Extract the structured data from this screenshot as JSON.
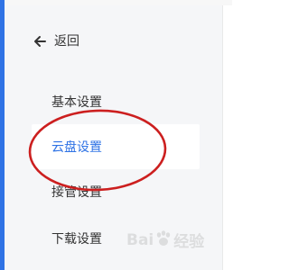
{
  "nav": {
    "back_label": "返回",
    "back_icon": "arrow-left-icon"
  },
  "menu": {
    "items": [
      {
        "label": "基本设置",
        "active": false
      },
      {
        "label": "云盘设置",
        "active": true
      },
      {
        "label": "接管设置",
        "active": false
      },
      {
        "label": "下载设置",
        "active": false
      }
    ]
  },
  "watermark": {
    "text_left": "Bai",
    "text_right": "经验",
    "icon": "baidu-paw-icon"
  },
  "colors": {
    "accent": "#2f73e5",
    "annotation": "#cc1f1f",
    "sidebar_bg": "#f5f6f8",
    "text": "#333333"
  }
}
